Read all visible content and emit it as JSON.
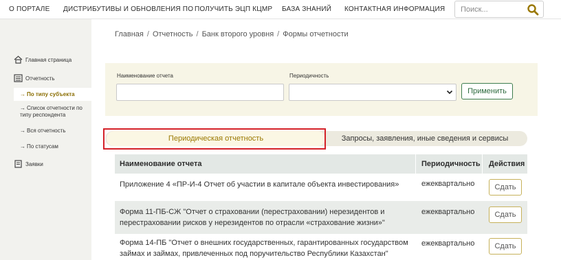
{
  "topnav": {
    "items": [
      "О ПОРТАЛЕ",
      "ДИСТРИБУТИВЫ И ОБНОВЛЕНИЯ ПО",
      "ПОЛУЧИТЬ ЭЦП КЦМР",
      "БАЗА ЗНАНИЙ",
      "КОНТАКТНАЯ ИНФОРМАЦИЯ"
    ],
    "search_placeholder": "Поиск..."
  },
  "sidebar": {
    "home": "Главная страница",
    "reporting": "Отчетность",
    "sub": [
      "По типу субъекта",
      "Список отчетности по типу респондента",
      "Вся отчетность",
      "По статусам"
    ],
    "requests": "Заявки"
  },
  "breadcrumb": [
    "Главная",
    "Отчетность",
    "Банк второго уровня",
    "Формы отчетности"
  ],
  "filter": {
    "name_label": "Наименование отчета",
    "name_value": "",
    "period_label": "Периодичность",
    "period_value": "",
    "apply": "Применить"
  },
  "tabs": [
    "Периодическая отчетность",
    "Запросы, заявления, иные сведения и сервисы"
  ],
  "table": {
    "headers": [
      "Наименование отчета",
      "Периодичность",
      "Действия"
    ],
    "rows": [
      {
        "name": "Приложение 4 «ПР-И-4 Отчет об участии в капитале объекта инвестирования»",
        "period": "ежеквартально",
        "action": "Сдать"
      },
      {
        "name": "Форма 11-ПБ-СЖ \"Отчет о страховании (перестраховании) нерезидентов и перестраховании рисков у нерезидентов по отрасли «страхование жизни»\"",
        "period": "ежеквартально",
        "action": "Сдать"
      },
      {
        "name": "Форма 14-ПБ \"Отчет о внешних государственных, гарантированных государством займах и займах, привлеченных под поручительство Республики Казахстан\"",
        "period": "ежеквартально",
        "action": "Сдать"
      }
    ]
  },
  "colors": {
    "accent": "#9a7800",
    "apply_border": "#3e7d4f",
    "highlight": "#d42128"
  }
}
